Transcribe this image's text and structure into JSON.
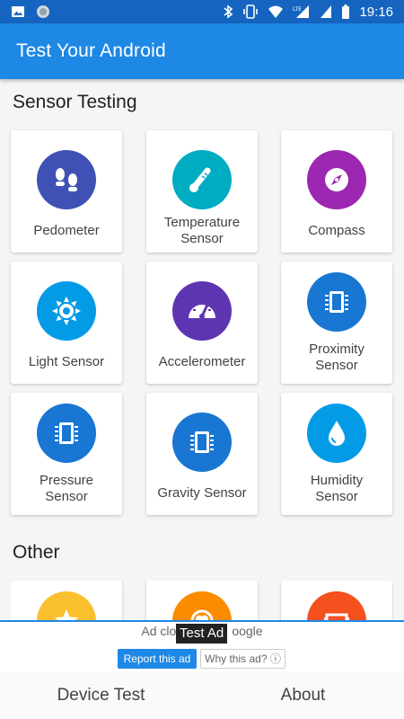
{
  "status_bar": {
    "time": "19:16"
  },
  "app_bar": {
    "title": "Test Your Android"
  },
  "sections": {
    "sensor_testing": "Sensor Testing",
    "other": "Other"
  },
  "sensor_cards": [
    {
      "label": "Pedometer",
      "icon": "footprints-icon",
      "color": "#3f51b5"
    },
    {
      "label": "Temperature Sensor",
      "icon": "thermometer-icon",
      "color": "#00acc1"
    },
    {
      "label": "Compass",
      "icon": "compass-icon",
      "color": "#9c27b0"
    },
    {
      "label": "Light Sensor",
      "icon": "sun-icon",
      "color": "#039be5"
    },
    {
      "label": "Accelerometer",
      "icon": "speedometer-icon",
      "color": "#5e35b1"
    },
    {
      "label": "Proximity Sensor",
      "icon": "chip-icon",
      "color": "#1976d2"
    },
    {
      "label": "Pressure Sensor",
      "icon": "chip-icon",
      "color": "#1976d2"
    },
    {
      "label": "Gravity Sensor",
      "icon": "chip-icon",
      "color": "#1976d2"
    },
    {
      "label": "Humidity Sensor",
      "icon": "drop-icon",
      "color": "#039be5"
    }
  ],
  "other_cards": [
    {
      "icon": "star-icon",
      "color": "#fbc02d"
    },
    {
      "icon": "heart-icon",
      "color": "#fb8c00"
    },
    {
      "icon": "screen-icon",
      "color": "#f4511e"
    }
  ],
  "ad": {
    "top_text": "Ad clo",
    "top_text_tail": "oogle",
    "test_ad": "Test Ad",
    "report_label": "Report this ad",
    "why_label": "Why this ad? ⓘ"
  },
  "bottom_nav": {
    "device_test": "Device Test",
    "about": "About"
  },
  "colors": {
    "primary": "#1e88e5",
    "status_bar": "#1565c0"
  }
}
